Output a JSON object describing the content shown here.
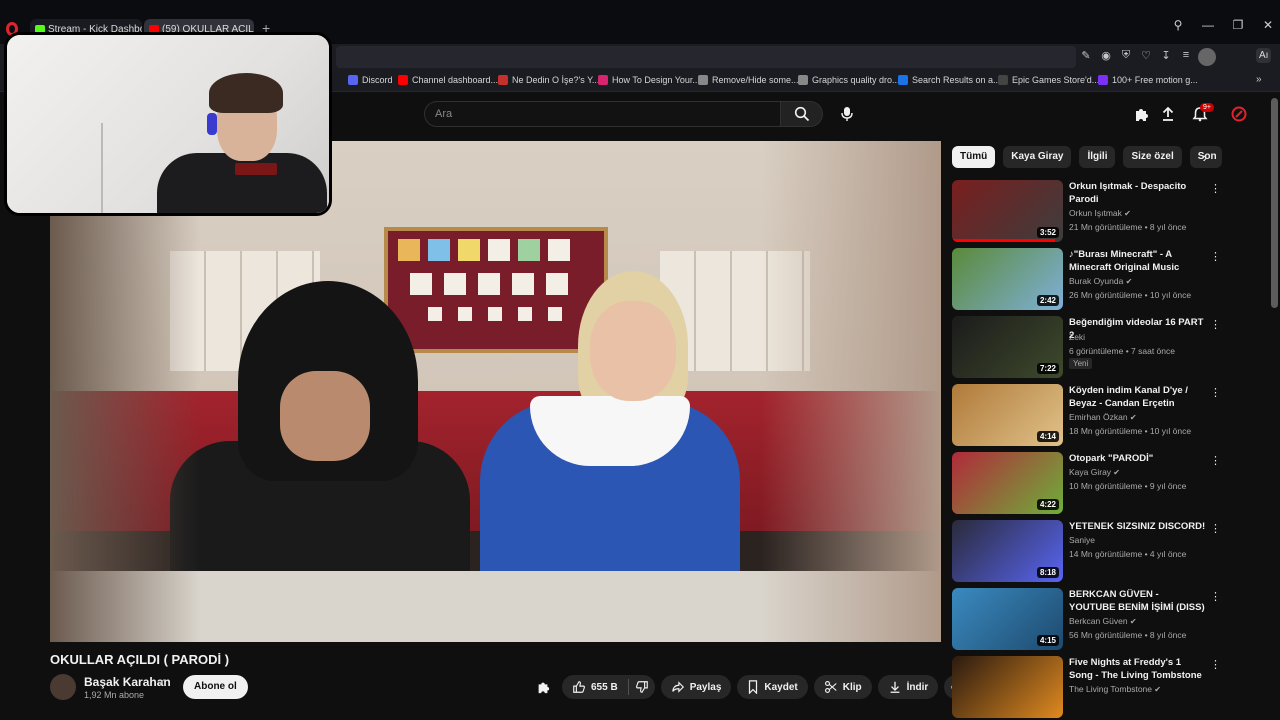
{
  "browser": {
    "tabs": [
      {
        "label": "Stream - Kick Dashboard",
        "icon_color": "#53fc18"
      },
      {
        "label": "(59) OKULLAR AÇILDI",
        "icon_color": "#ff0000"
      }
    ],
    "new_tab_label": "+"
  },
  "bookmarks": [
    {
      "label": "Discord",
      "icon_color": "#5865f2"
    },
    {
      "label": "Channel dashboard...",
      "icon_color": "#ff0000"
    },
    {
      "label": "Ne Dedin O İşe?'s Y...",
      "icon_color": "#c4302b"
    },
    {
      "label": "How To Design Your...",
      "icon_color": "#d6246e"
    },
    {
      "label": "Remove/Hide some...",
      "icon_color": "#888888"
    },
    {
      "label": "Graphics quality dro...",
      "icon_color": "#888888"
    },
    {
      "label": "Search Results on a...",
      "icon_color": "#1a73e8"
    },
    {
      "label": "Epic Games Store'd...",
      "icon_color": "#444444"
    },
    {
      "label": "100+ Free motion g...",
      "icon_color": "#7b2ff7"
    }
  ],
  "header": {
    "search_placeholder": "Ara",
    "notification_count": "9+"
  },
  "video": {
    "title": "OKULLAR AÇILDI ( PARODİ )",
    "channel": "Başak Karahan",
    "subscribers": "1,92 Mn abone",
    "subscribe_label": "Abone ol",
    "likes": "655 B",
    "share_label": "Paylaş",
    "save_label": "Kaydet",
    "clip_label": "Klip",
    "download_label": "İndir"
  },
  "chips": [
    "Tümü",
    "Kaya Giray",
    "İlgili",
    "Size özel",
    "Son"
  ],
  "recommendations": [
    {
      "title": "Orkun Işıtmak - Despacito Parodi",
      "channel": "Orkun Işıtmak",
      "verified": true,
      "meta": "21 Mn görüntüleme • 8 yıl önce",
      "duration": "3:52",
      "thumb_colors": [
        "#7a1e1e",
        "#3d3d3d"
      ],
      "progress": 0.93
    },
    {
      "title": "♪\"Burası Minecraft\" - A Minecraft Original Music Vide...",
      "channel": "Burak Oyunda",
      "verified": true,
      "meta": "26 Mn görüntüleme • 10 yıl önce",
      "duration": "2:42",
      "thumb_colors": [
        "#5a8a3a",
        "#7fb0d8"
      ],
      "progress": 0
    },
    {
      "title": "Beğendiğim videolar 16 PART 2",
      "channel": "Zeki",
      "verified": false,
      "meta": "6 görüntüleme • 7 saat önce",
      "badge": "Yeni",
      "duration": "7:22",
      "thumb_colors": [
        "#1b1b1b",
        "#3e4a2c"
      ],
      "progress": 0
    },
    {
      "title": "Köyden indim Kanal D'ye / Beyaz - Candan Erçetin atışma...",
      "channel": "Emirhan Özkan",
      "verified": true,
      "meta": "18 Mn görüntüleme • 10 yıl önce",
      "duration": "4:14",
      "thumb_colors": [
        "#b07a3a",
        "#e0c28a"
      ],
      "progress": 0
    },
    {
      "title": "Otopark \"PARODİ\"",
      "channel": "Kaya Giray",
      "verified": true,
      "meta": "10 Mn görüntüleme • 9 yıl önce",
      "duration": "4:22",
      "thumb_colors": [
        "#b02a3a",
        "#6fae3a"
      ],
      "progress": 0
    },
    {
      "title": "YETENEK SIZSINIZ DISCORD!",
      "channel": "Saniye",
      "verified": false,
      "meta": "14 Mn görüntüleme • 4 yıl önce",
      "duration": "8:18",
      "thumb_colors": [
        "#2a2a3a",
        "#5865f2"
      ],
      "progress": 0
    },
    {
      "title": "BERKCAN GÜVEN - YOUTUBE BENİM İŞİMİ (DISS)",
      "channel": "Berkcan Güven",
      "verified": true,
      "meta": "56 Mn görüntüleme • 8 yıl önce",
      "duration": "4:15",
      "thumb_colors": [
        "#3a8ac0",
        "#1e4a6e"
      ],
      "progress": 0
    },
    {
      "title": "Five Nights at Freddy's 1 Song - The Living Tombstone",
      "channel": "The Living Tombstone",
      "verified": true,
      "meta": "",
      "duration": "",
      "thumb_colors": [
        "#2a1a10",
        "#e08a20"
      ],
      "progress": 0
    }
  ]
}
